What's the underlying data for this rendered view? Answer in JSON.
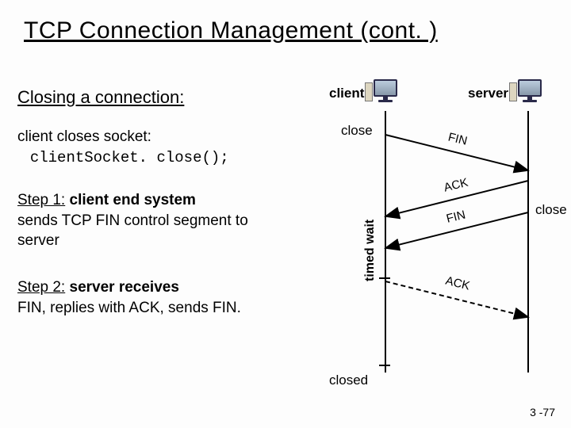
{
  "title": "TCP Connection Management (cont. )",
  "subhead": "Closing a connection:",
  "code": {
    "line1": "client closes socket:",
    "line2": "clientSocket. close();"
  },
  "step1": {
    "lead": "Step 1:",
    "bold": " client end system",
    "rest": "sends TCP FIN control segment to server"
  },
  "step2": {
    "lead": "Step 2:",
    "bold": " server receives",
    "rest": "FIN, replies with ACK, sends FIN."
  },
  "diagram": {
    "client_label": "client",
    "server_label": "server",
    "close_client": "close",
    "close_server": "close",
    "closed": "closed",
    "timed_wait": "timed wait",
    "msg_fin1": "FIN",
    "msg_ack1": "ACK",
    "msg_fin2": "FIN",
    "msg_ack2": "ACK"
  },
  "footer": "3 -77",
  "chart_data": {
    "type": "table",
    "description": "TCP connection close sequence diagram",
    "endpoints": [
      "client",
      "server"
    ],
    "events": [
      {
        "at": "client",
        "action": "close",
        "t": 0
      },
      {
        "from": "client",
        "to": "server",
        "label": "FIN",
        "t0": 0,
        "t1": 1
      },
      {
        "from": "server",
        "to": "client",
        "label": "ACK",
        "t0": 1,
        "t1": 2
      },
      {
        "at": "server",
        "action": "close",
        "t": 1
      },
      {
        "from": "server",
        "to": "client",
        "label": "FIN",
        "t0": 1.3,
        "t1": 2.3
      },
      {
        "from": "client",
        "to": "server",
        "label": "ACK",
        "t0": 2.3,
        "t1": 3.3
      },
      {
        "at": "client",
        "state": "timed wait",
        "t_start": 2.3,
        "t_end": 4
      },
      {
        "at": "client",
        "action": "closed",
        "t": 4
      }
    ]
  }
}
